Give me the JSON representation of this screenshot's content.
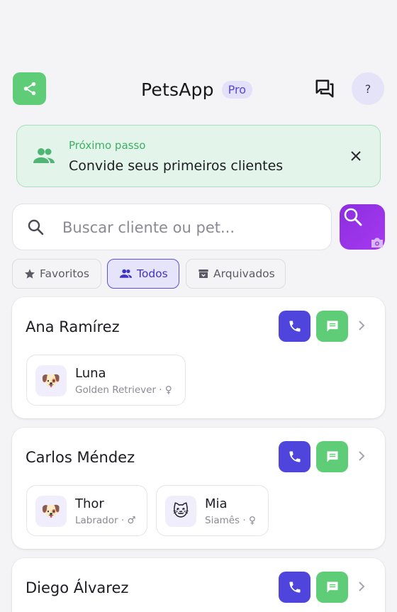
{
  "header": {
    "title": "PetsApp",
    "badge": "Pro",
    "help_label": "?"
  },
  "banner": {
    "kicker": "Próximo passo",
    "text": "Convide seus primeiros clientes"
  },
  "search": {
    "placeholder": "Buscar cliente ou pet..."
  },
  "filters": [
    {
      "label": "Favoritos",
      "active": false
    },
    {
      "label": "Todos",
      "active": true
    },
    {
      "label": "Arquivados",
      "active": false
    }
  ],
  "clients": [
    {
      "name": "Ana Ramírez",
      "pets": [
        {
          "name": "Luna",
          "meta": "Golden Retriever · ♀",
          "emoji": "🐶"
        }
      ]
    },
    {
      "name": "Carlos Méndez",
      "pets": [
        {
          "name": "Thor",
          "meta": "Labrador · ♂",
          "emoji": "🐶"
        },
        {
          "name": "Mia",
          "meta": "Siamês · ♀",
          "emoji": "🐱"
        }
      ]
    },
    {
      "name": "Diego Álvarez",
      "pets": []
    }
  ],
  "colors": {
    "primary": "#4f45dc",
    "green": "#5fcd78",
    "purple_gradient_start": "#8c2de0",
    "banner_bg": "#e3f5ea"
  }
}
